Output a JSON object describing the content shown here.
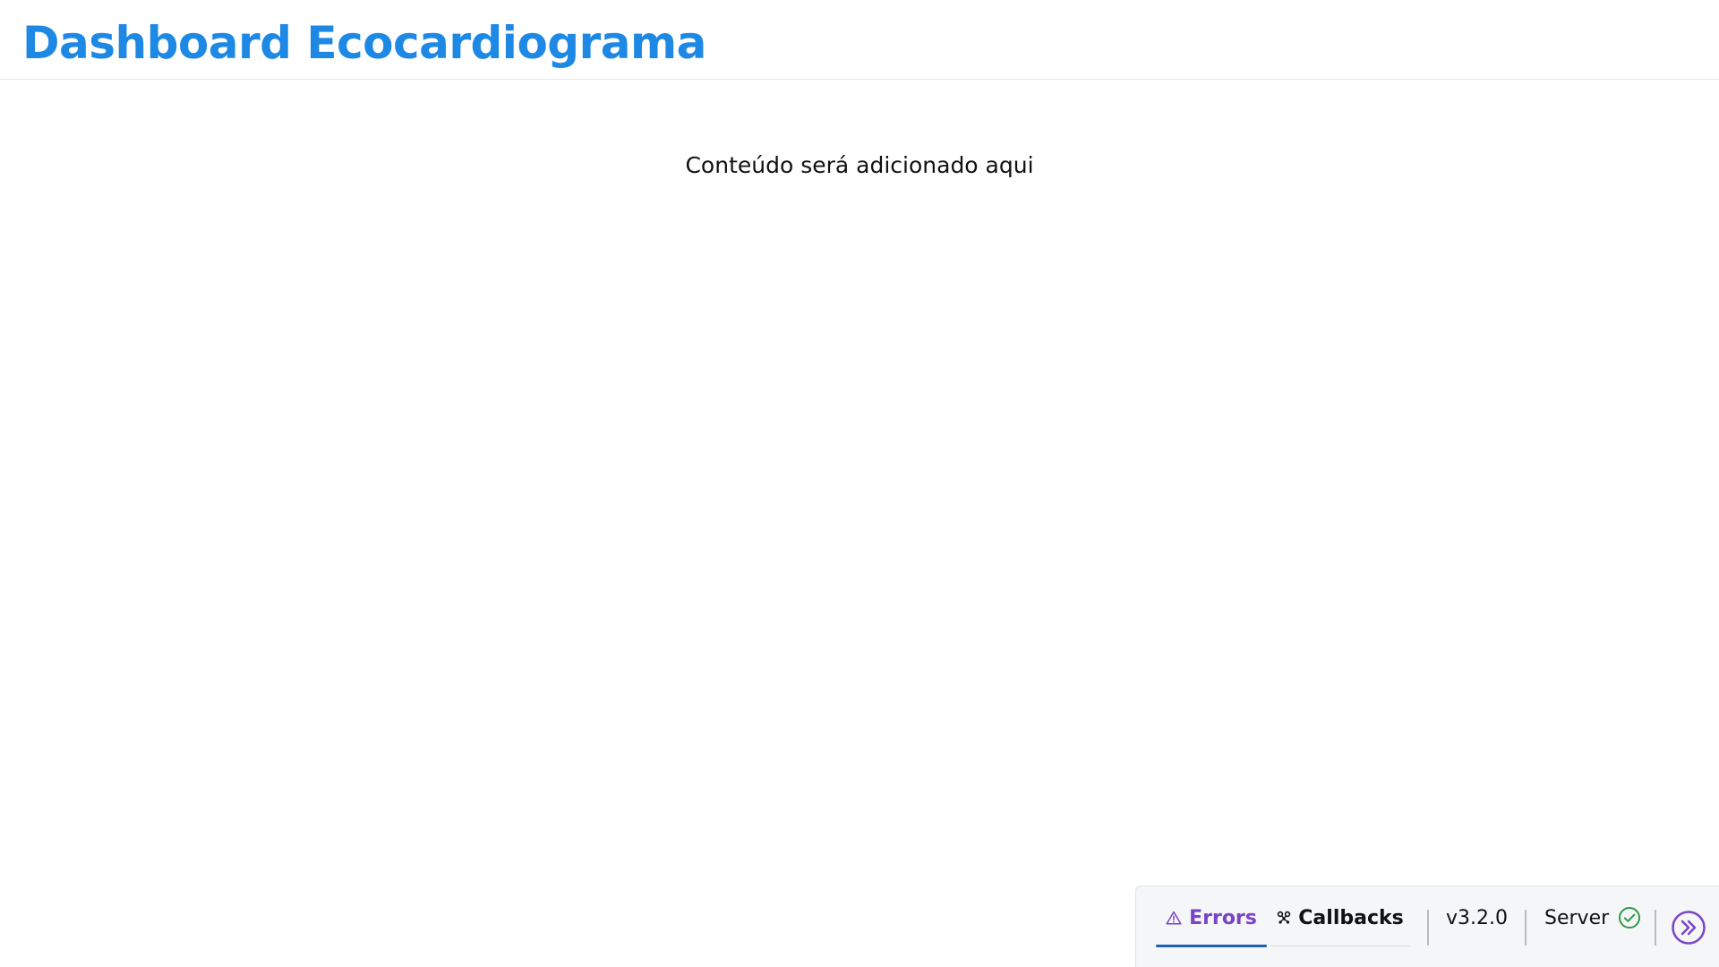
{
  "header": {
    "title": "Dashboard Ecocardiograma"
  },
  "main": {
    "placeholder": "Conteúdo será adicionado aqui"
  },
  "devtools": {
    "tabs": [
      {
        "label": "Errors",
        "icon": "warning-icon",
        "active": true
      },
      {
        "label": "Callbacks",
        "icon": "callbacks-graph-icon",
        "active": false
      }
    ],
    "version": "v3.2.0",
    "server_label": "Server",
    "server_status_icon": "check-circle-icon",
    "collapse_icon": "double-chevron-right-icon",
    "colors": {
      "title": "#1e88e5",
      "active_tab": "#7a44c8",
      "active_underline": "#1e5fb8",
      "server_ok": "#2e9a47",
      "collapse_button": "#7a44c8"
    }
  }
}
